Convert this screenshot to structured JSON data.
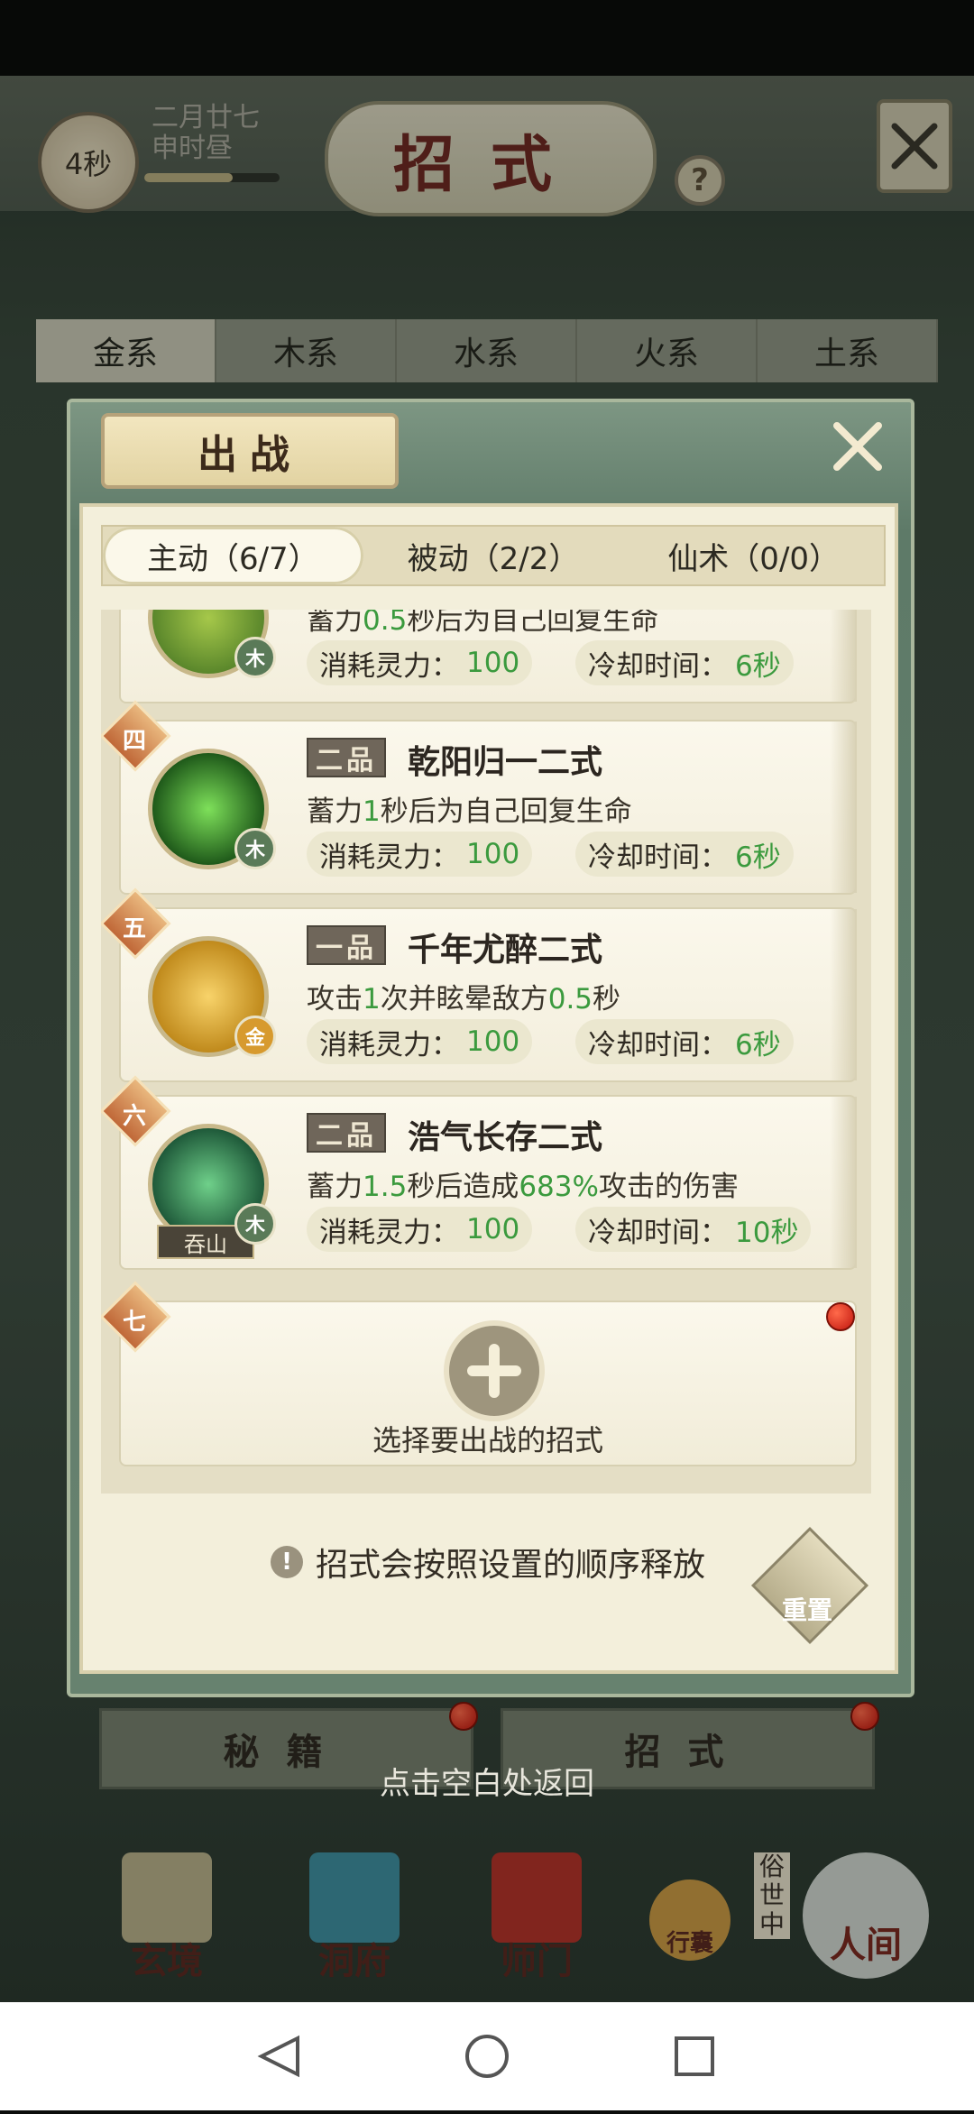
{
  "header": {
    "timer": "4秒",
    "date_line1": "二月廿七",
    "date_line2": "申时昼",
    "title": "招式",
    "help_label": "?"
  },
  "element_tabs": [
    "金系",
    "木系",
    "水系",
    "火系",
    "土系"
  ],
  "dialog": {
    "title": "出战",
    "mode_tabs": [
      "主动（6/7）",
      "被动（2/2）",
      "仙术（0/0）"
    ],
    "skills": [
      {
        "rank": "",
        "grade": "",
        "name": "",
        "element": "木",
        "desc_parts": [
          "蓄力",
          "0.5",
          "秒后为自己回复生命"
        ],
        "cost_label": "消耗灵力：",
        "cost": "100",
        "cooldown_label": "冷却时间：",
        "cooldown": "6秒"
      },
      {
        "rank": "四",
        "grade": "二品",
        "name": "乾阳归一二式",
        "element": "木",
        "desc_parts": [
          "蓄力",
          "1",
          "秒后为自己回复生命"
        ],
        "cost_label": "消耗灵力：",
        "cost": "100",
        "cooldown_label": "冷却时间：",
        "cooldown": "6秒"
      },
      {
        "rank": "五",
        "grade": "一品",
        "name": "千年尤醉二式",
        "element": "金",
        "desc_parts": [
          "攻击",
          "1",
          "次并眩晕敌方",
          "0.5",
          "秒"
        ],
        "cost_label": "消耗灵力：",
        "cost": "100",
        "cooldown_label": "冷却时间：",
        "cooldown": "6秒"
      },
      {
        "rank": "六",
        "grade": "二品",
        "name": "浩气长存二式",
        "element": "木",
        "tag": "吞山",
        "desc_parts": [
          "蓄力",
          "1.5",
          "秒后造成",
          "683%",
          "攻击的伤害"
        ],
        "cost_label": "消耗灵力：",
        "cost": "100",
        "cooldown_label": "冷却时间：",
        "cooldown": "10秒"
      }
    ],
    "empty_slot": {
      "rank": "七",
      "label": "选择要出战的招式"
    },
    "hint": "招式会按照设置的顺序释放",
    "reset_label": "重置"
  },
  "sub_tabs": [
    "秘籍",
    "招式"
  ],
  "return_hint": "点击空白处返回",
  "nav": [
    "玄境",
    "洞府",
    "师门",
    "行囊",
    "人间"
  ],
  "nav_side": "俗世中",
  "colors": {
    "highlight_green": "#3b9a3e",
    "title_red": "#6e2a23",
    "dot_red": "#c1160e"
  }
}
